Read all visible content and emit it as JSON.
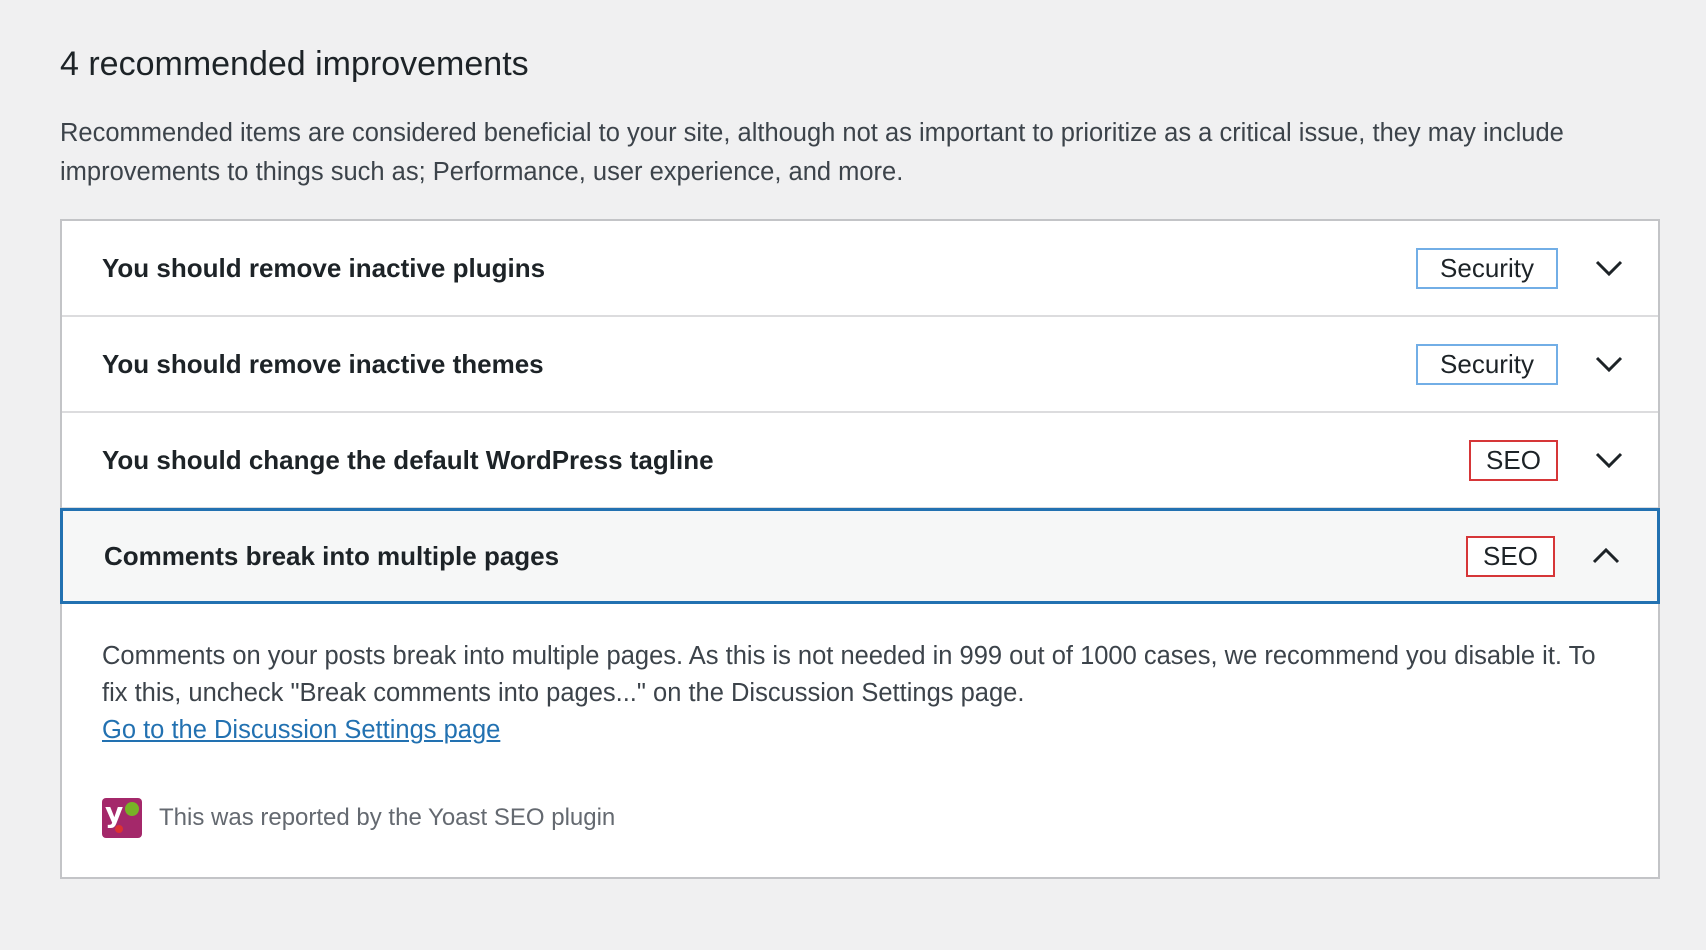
{
  "section": {
    "title": "4 recommended improvements",
    "description": "Recommended items are considered beneficial to your site, although not as important to prioritize as a critical issue, they may include improvements to things such as; Performance, user experience, and more."
  },
  "items": [
    {
      "title": "You should remove inactive plugins",
      "badge": "Security",
      "badge_color": "#72aee6",
      "expanded": false,
      "icon": "chevron-down-icon"
    },
    {
      "title": "You should remove inactive themes",
      "badge": "Security",
      "badge_color": "#72aee6",
      "expanded": false,
      "icon": "chevron-down-icon"
    },
    {
      "title": "You should change the default WordPress tagline",
      "badge": "SEO",
      "badge_color": "#d63638",
      "expanded": false,
      "icon": "chevron-down-icon"
    },
    {
      "title": "Comments break into multiple pages",
      "badge": "SEO",
      "badge_color": "#d63638",
      "expanded": true,
      "icon": "chevron-up-icon"
    }
  ],
  "panel": {
    "text": "Comments on your posts break into multiple pages. As this is not needed in 999 out of 1000 cases, we recommend you disable it. To fix this, uncheck \"Break comments into pages...\" on the Discussion Settings page.",
    "link": "Go to the Discussion Settings page",
    "reported_by": "This was reported by the Yoast SEO plugin",
    "reporter_icon": "yoast-logo-icon"
  },
  "colors": {
    "accent": "#2271b1",
    "security": "#72aee6",
    "seo": "#d63638"
  }
}
